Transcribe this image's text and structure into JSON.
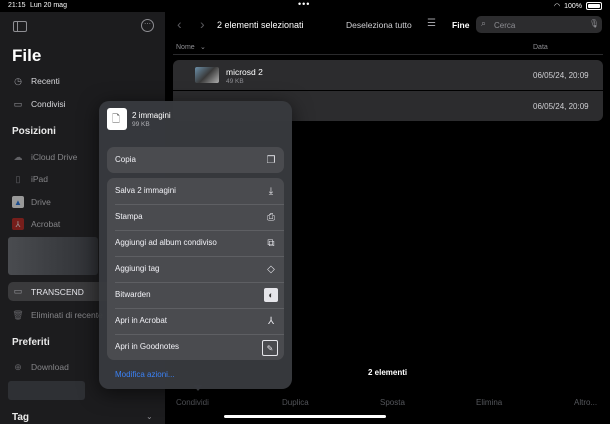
{
  "status": {
    "time": "21:15",
    "date": "Lun 20 mag",
    "dots": "•••",
    "battery": "100%"
  },
  "sidebar": {
    "title": "File",
    "recents": "Recenti",
    "shared": "Condivisi",
    "locations_header": "Posizioni",
    "locations": [
      "iCloud Drive",
      "iPad",
      "Drive",
      "Acrobat",
      "TRANSCEND",
      "Eliminati di recente"
    ],
    "favorites_header": "Preferiti",
    "downloads": "Download",
    "tags_header": "Tag"
  },
  "toolbar": {
    "back": "‹",
    "forward": "›",
    "title": "2 elementi selezionati",
    "deselect": "Deseleziona tutto",
    "done": "Fine",
    "search_placeholder": "Cerca"
  },
  "columns": {
    "name": "Nome",
    "date": "Data"
  },
  "files": [
    {
      "name": "microsd 2",
      "size": "49 KB",
      "date": "06/05/24, 20:09"
    },
    {
      "name": "",
      "size": "",
      "date": "06/05/24, 20:09"
    }
  ],
  "footer": {
    "count": "2 elementi"
  },
  "bottom_bar": [
    "Condividi",
    "Duplica",
    "Sposta",
    "Elimina",
    "Altro..."
  ],
  "popup": {
    "title": "2 immagini",
    "subtitle": "99 KB",
    "copy": {
      "label": "Copia",
      "icon": "copy-icon"
    },
    "actions": [
      {
        "label": "Salva 2 immagini",
        "icon": "save-icon"
      },
      {
        "label": "Stampa",
        "icon": "printer-icon"
      },
      {
        "label": "Aggiungi ad album condiviso",
        "icon": "shared-album-icon"
      },
      {
        "label": "Aggiungi tag",
        "icon": "tag-icon"
      },
      {
        "label": "Bitwarden",
        "icon": "bitwarden-icon"
      },
      {
        "label": "Apri in Acrobat",
        "icon": "acrobat-icon"
      },
      {
        "label": "Apri in Goodnotes",
        "icon": "goodnotes-icon"
      }
    ],
    "edit_actions": "Modifica azioni..."
  },
  "colors": {
    "accent": "#3b82f6",
    "sidebar_bg": "#1c1c1e",
    "popup_bg": "#383a3e",
    "menu_group_bg": "#4a4b4f"
  }
}
